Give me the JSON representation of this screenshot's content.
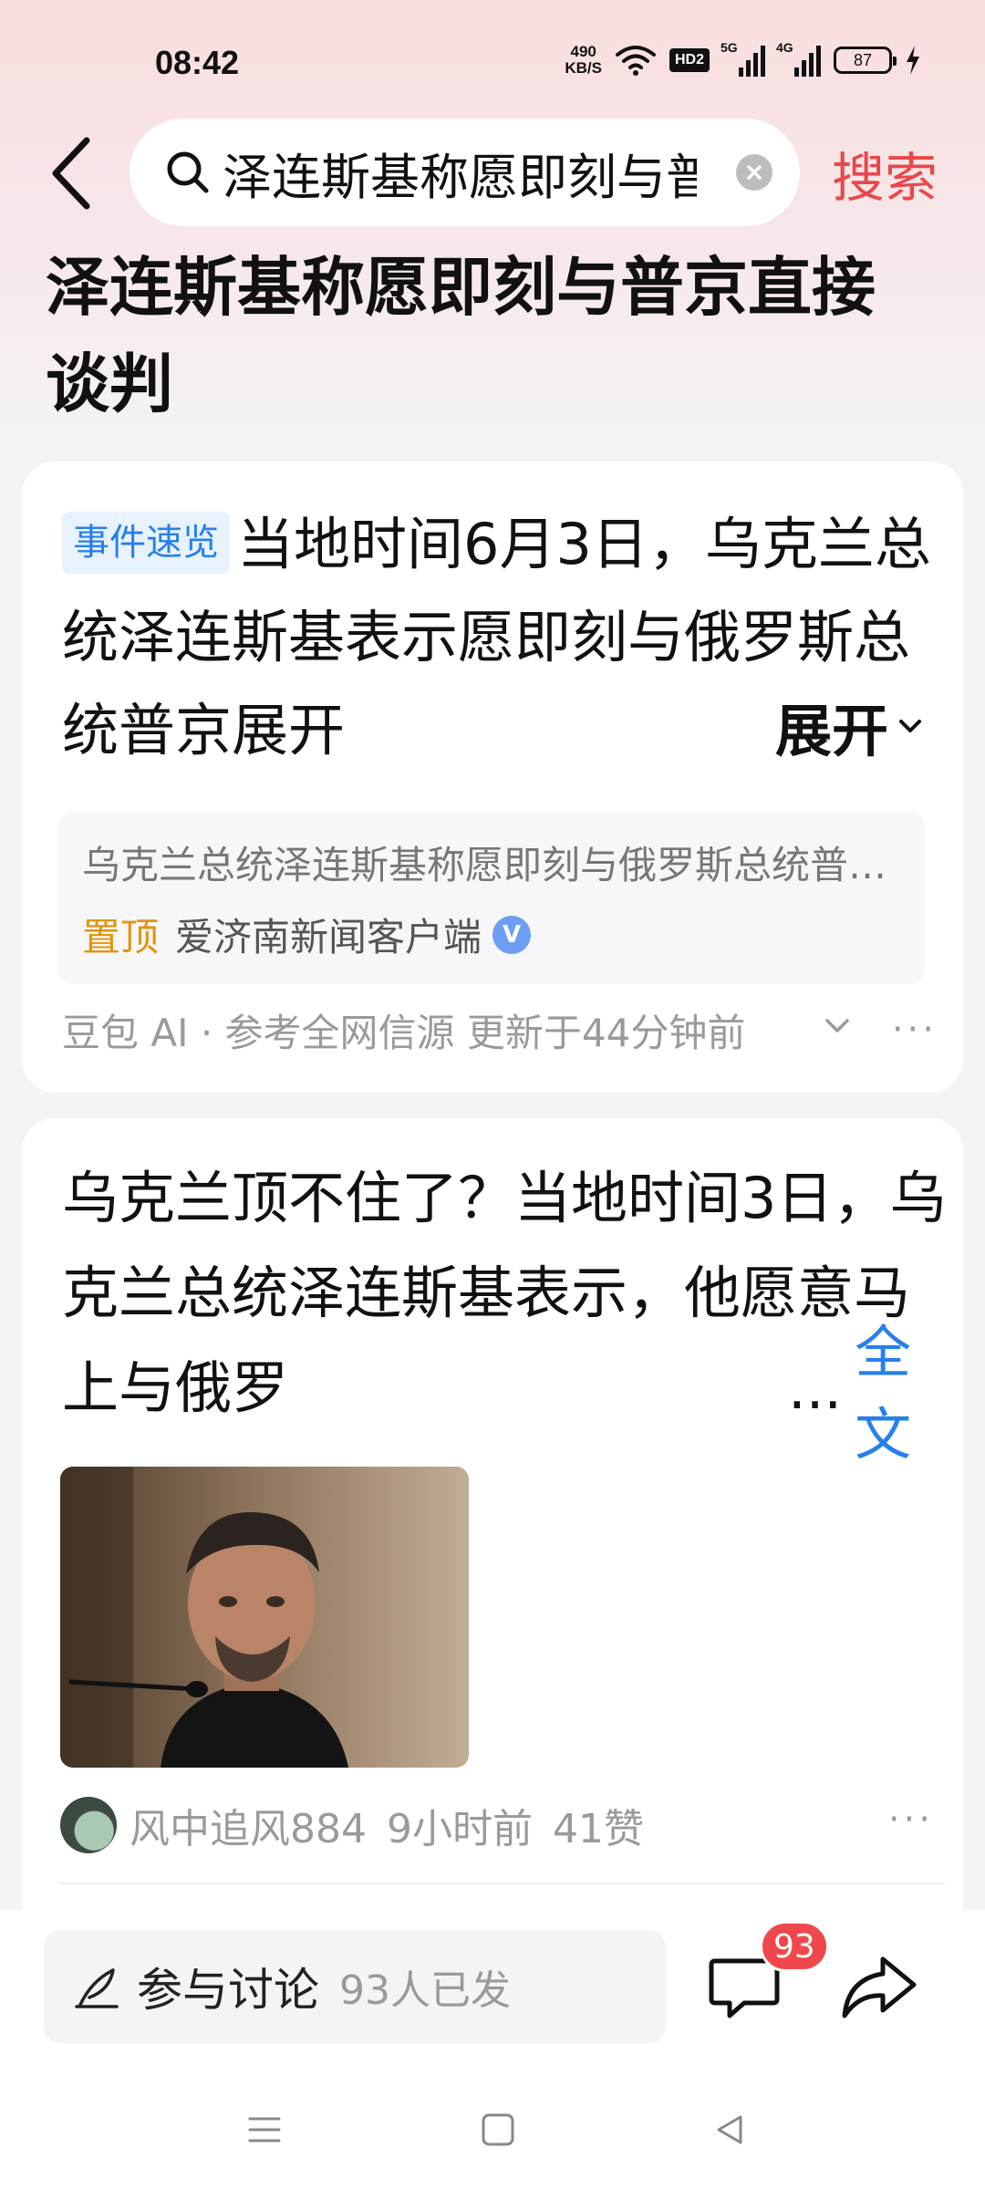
{
  "status_bar": {
    "time": "08:42",
    "net_speed_value": "490",
    "net_speed_unit": "KB/S",
    "hd_label": "HD2",
    "signal1_label": "5G",
    "signal2_label": "4G",
    "battery": "87"
  },
  "header": {
    "search_query": "泽连斯基称愿即刻与普京直接谈判",
    "search_button": "搜索"
  },
  "page_title": "泽连斯基称愿即刻与普京直接谈判",
  "event_card": {
    "tag": "事件速览",
    "summary": "当地时间6月3日，乌克兰总统泽连斯基表示愿即刻与俄罗斯总统普京展开",
    "expand_label": "展开",
    "source_title": "乌克兰总统泽连斯基称愿即刻与俄罗斯总统普京直接谈判",
    "source_pin": "置顶",
    "source_name": "爱济南新闻客户端",
    "verified_mark": "V",
    "footer": "豆包 AI · 参考全网信源 更新于44分钟前",
    "more": "···"
  },
  "post": {
    "text": "乌克兰顶不住了？当地时间3日，乌克兰总统泽连斯基表示，他愿意马上与俄罗",
    "ellipsis": "...",
    "fulltext_link": "全文",
    "image_icon": "person-portrait",
    "author": "风中追风884",
    "time": "9小时前",
    "likes": "41赞",
    "more": "···"
  },
  "bottom_bar": {
    "discuss_label": "参与讨论",
    "discuss_count": "93人已发",
    "comment_badge": "93"
  },
  "colors": {
    "accent_red": "#e8484a",
    "link_blue": "#2680eb",
    "pin_orange": "#e0950e"
  }
}
